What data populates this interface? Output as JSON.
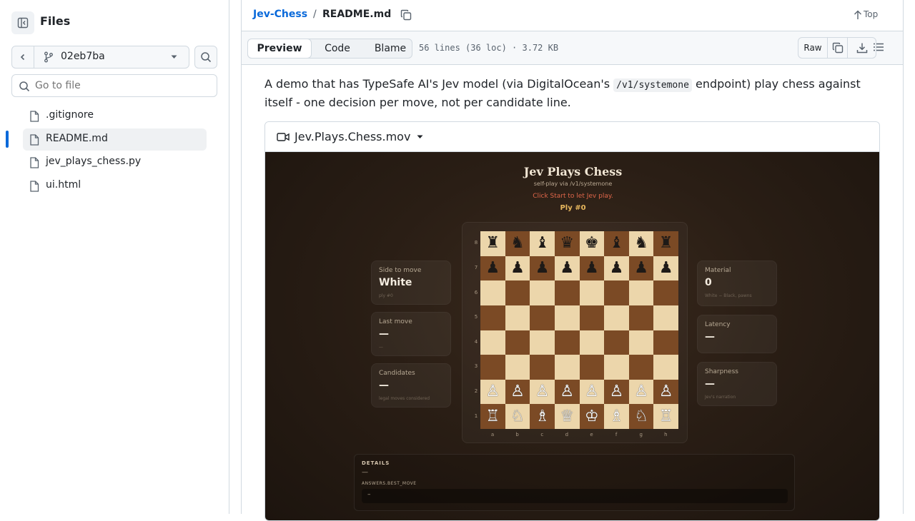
{
  "sidebar": {
    "title": "Files",
    "branch": "02eb7ba",
    "goto_placeholder": "Go to file",
    "files": [
      {
        "name": ".gitignore"
      },
      {
        "name": "README.md",
        "selected": true
      },
      {
        "name": "jev_plays_chess.py"
      },
      {
        "name": "ui.html"
      }
    ]
  },
  "header": {
    "repo": "Jev-Chess",
    "separator": "/",
    "file": "README.md",
    "top_label": "Top"
  },
  "toolbar": {
    "tabs": [
      "Preview",
      "Code",
      "Blame"
    ],
    "active_tab": "Preview",
    "meta": "56 lines (36 loc) · 3.72 KB",
    "raw_label": "Raw"
  },
  "readme": {
    "intro_before": "A demo that has TypeSafe AI's Jev model (via DigitalOcean's ",
    "intro_code": "/v1/systemone",
    "intro_after": " endpoint) play chess against itself - one decision per move, not per candidate line.",
    "video_name": "Jev.Plays.Chess.mov"
  },
  "game": {
    "title": "Jev Plays Chess",
    "subtitle": "self-play via /v1/systemone",
    "hint": "Click Start to let Jev play.",
    "ply": "Ply #0",
    "cards_left": [
      {
        "label": "Side to move",
        "value": "White",
        "sub": "ply #0"
      },
      {
        "label": "Last move",
        "value": "—",
        "sub": "—"
      },
      {
        "label": "Candidates",
        "value": "—",
        "sub": "legal moves considered"
      }
    ],
    "cards_right": [
      {
        "label": "Material",
        "value": "0",
        "sub": "White − Black, pawns"
      },
      {
        "label": "Latency",
        "value": "—",
        "sub": ""
      },
      {
        "label": "Sharpness",
        "value": "—",
        "sub": "Jev's narration"
      }
    ],
    "ranks": [
      "8",
      "7",
      "6",
      "5",
      "4",
      "3",
      "2",
      "1"
    ],
    "files": [
      "a",
      "b",
      "c",
      "d",
      "e",
      "f",
      "g",
      "h"
    ],
    "board": [
      [
        "♜",
        "♞",
        "♝",
        "♛",
        "♚",
        "♝",
        "♞",
        "♜"
      ],
      [
        "♟",
        "♟",
        "♟",
        "♟",
        "♟",
        "♟",
        "♟",
        "♟"
      ],
      [
        "",
        "",
        "",
        "",
        "",
        "",
        "",
        ""
      ],
      [
        "",
        "",
        "",
        "",
        "",
        "",
        "",
        ""
      ],
      [
        "",
        "",
        "",
        "",
        "",
        "",
        "",
        ""
      ],
      [
        "",
        "",
        "",
        "",
        "",
        "",
        "",
        ""
      ],
      [
        "♙",
        "♙",
        "♙",
        "♙",
        "♙",
        "♙",
        "♙",
        "♙"
      ],
      [
        "♖",
        "♘",
        "♗",
        "♕",
        "♔",
        "♗",
        "♘",
        "♖"
      ]
    ],
    "details_title": "DETAILS",
    "details_value": "—",
    "best_move_label": "ANSWERS.BEST_MOVE",
    "best_move_value": "–"
  },
  "colors": {
    "accent": "#0969da",
    "board_light": "#ecd6ab",
    "board_dark": "#7b4a25"
  }
}
